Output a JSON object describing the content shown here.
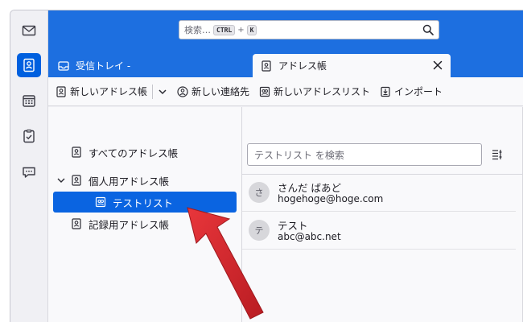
{
  "spaces": {
    "items": [
      {
        "name": "mail",
        "icon": "mail-icon"
      },
      {
        "name": "address-book",
        "icon": "address-book-icon",
        "active": true
      },
      {
        "name": "calendar",
        "icon": "calendar-icon"
      },
      {
        "name": "tasks",
        "icon": "tasks-icon"
      },
      {
        "name": "chat",
        "icon": "chat-icon"
      }
    ]
  },
  "search": {
    "placeholder": "検索…",
    "key1": "CTRL",
    "plus": "+",
    "key2": "K"
  },
  "tabs": [
    {
      "label": "受信トレイ -",
      "icon": "inbox-icon"
    },
    {
      "label": "アドレス帳",
      "icon": "address-book-icon",
      "active": true
    }
  ],
  "toolbar": {
    "new_book": "新しいアドレス帳",
    "new_contact": "新しい連絡先",
    "new_list": "新しいアドレスリスト",
    "import": "インポート"
  },
  "books": {
    "all": "すべてのアドレス帳",
    "personal": "個人用アドレス帳",
    "test_list": "テストリスト",
    "collected": "記録用アドレス帳"
  },
  "contacts": {
    "search_placeholder": "テストリスト を検索",
    "items": [
      {
        "initial": "さ",
        "name": "さんだ ばあど",
        "email": "hogehoge@hoge.com"
      },
      {
        "initial": "テ",
        "name": "テスト",
        "email": "abc@abc.net"
      }
    ]
  },
  "colors": {
    "accent": "#1d6fe0",
    "selected": "#0a64e1",
    "arrow": "#d9262b"
  }
}
